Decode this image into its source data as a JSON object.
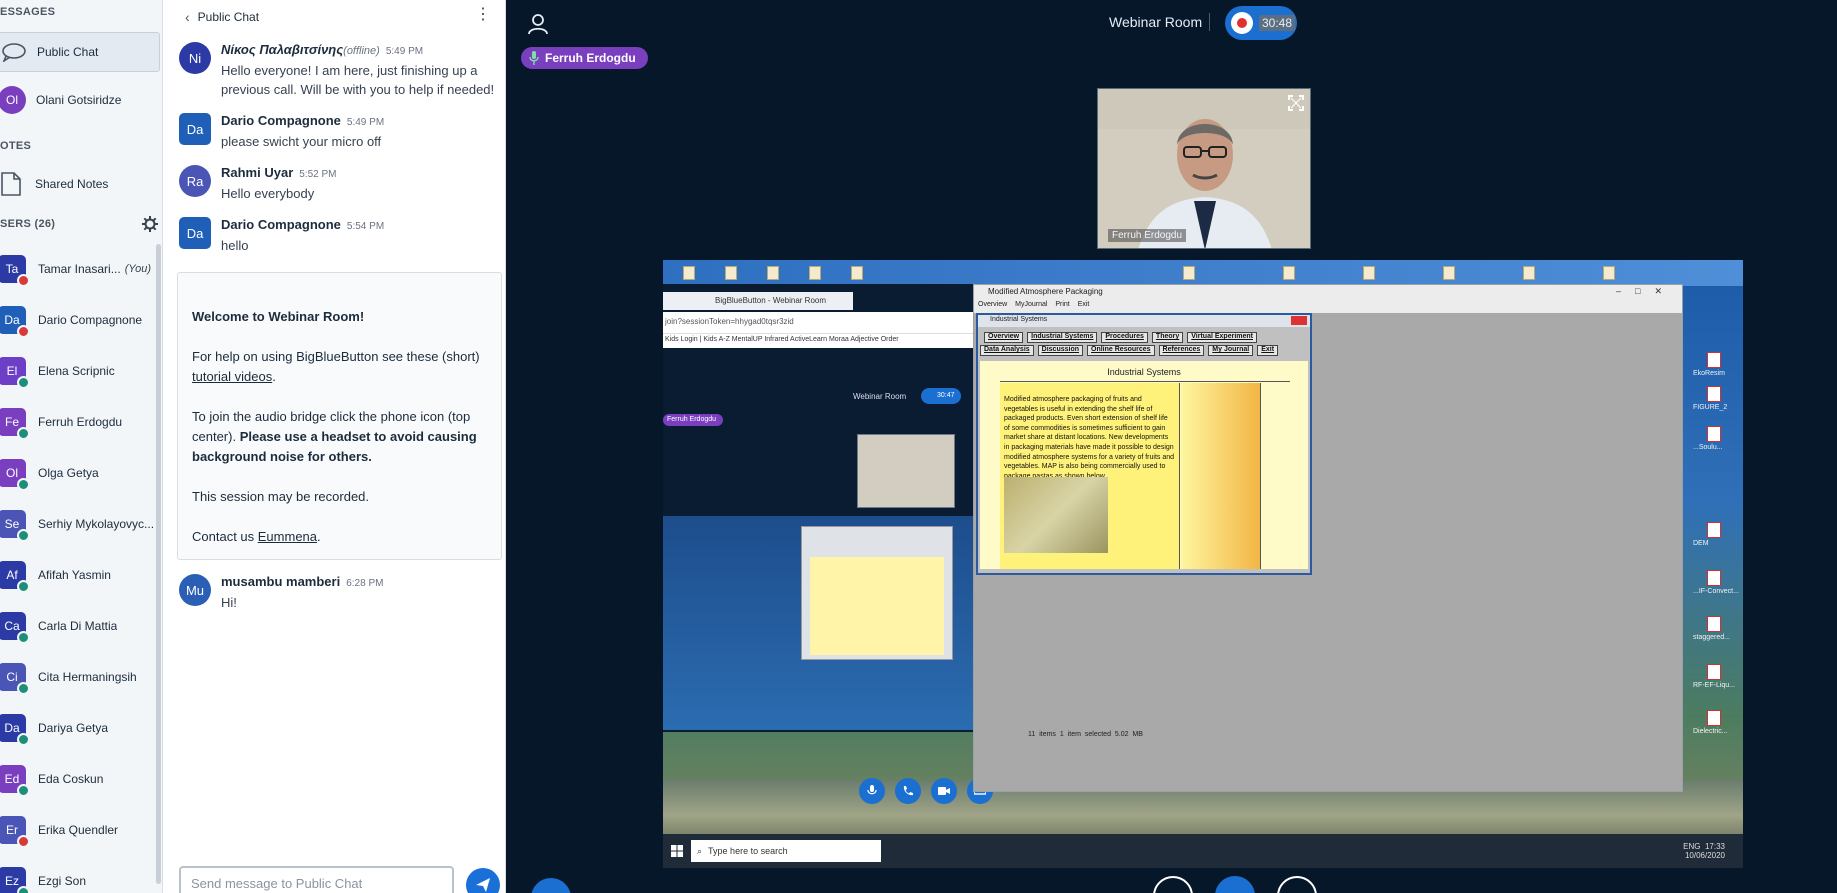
{
  "sidebar": {
    "messages_title": "ESSAGES",
    "public_chat_label": "Public Chat",
    "private_chat": {
      "initials": "Ol",
      "name": "Olani Gotsiridze"
    },
    "notes_title": "OTES",
    "shared_notes_label": "Shared Notes",
    "users_title": "SERS (26)",
    "you_label": "(You)",
    "users": [
      {
        "initials": "Ta",
        "name": "Tamar Inasari...",
        "color": "#2b3aa4",
        "status": "#d83a3a",
        "you": true
      },
      {
        "initials": "Da",
        "name": "Dario Compagnone",
        "color": "#1f5fb8",
        "status": "#d83a3a"
      },
      {
        "initials": "El",
        "name": "Elena Scripnic",
        "color": "#6c3fc6",
        "status": "#1b8f7a"
      },
      {
        "initials": "Fe",
        "name": "Ferruh Erdogdu",
        "color": "#7a3fbf",
        "status": "#1b8f7a"
      },
      {
        "initials": "Ol",
        "name": "Olga Getya",
        "color": "#7a3fbf",
        "status": "#1b8f7a"
      },
      {
        "initials": "Se",
        "name": "Serhiy Mykolayovyc...",
        "color": "#4a55b5",
        "status": "#1b8f7a"
      },
      {
        "initials": "Af",
        "name": "Afifah Yasmin",
        "color": "#2b3aa4",
        "status": "#1b8f7a"
      },
      {
        "initials": "Ca",
        "name": "Carla Di Mattia",
        "color": "#2b3aa4",
        "status": "#1b8f7a"
      },
      {
        "initials": "Ci",
        "name": "Cita Hermaningsih",
        "color": "#4a55b5",
        "status": "#1b8f7a"
      },
      {
        "initials": "Da",
        "name": "Dariya Getya",
        "color": "#2b3aa4",
        "status": "#1b8f7a"
      },
      {
        "initials": "Ed",
        "name": "Eda Coskun",
        "color": "#7a3fbf",
        "status": "#1b8f7a"
      },
      {
        "initials": "Er",
        "name": "Erika Quendler",
        "color": "#4a55b5",
        "status": "#d83a3a"
      },
      {
        "initials": "Ez",
        "name": "Ezgi Son",
        "color": "#2b3aa4",
        "status": "#1b8f7a"
      }
    ]
  },
  "chat": {
    "title": "Public Chat",
    "messages": [
      {
        "initials": "Ni",
        "name": "Νίκος Παλαβιτσίνης",
        "offline": "(offline)",
        "time": "5:49 PM",
        "text": "Hello everyone! I am here, just finishing up a previous call. Will be with you to help if needed!",
        "color": "#2b3aa4"
      },
      {
        "initials": "Da",
        "name": "Dario Compagnone",
        "time": "5:49 PM",
        "text": "please swicht your micro off",
        "color": "#1f5fb8"
      },
      {
        "initials": "Ra",
        "name": "Rahmi Uyar",
        "time": "5:52 PM",
        "text": "Hello everybody",
        "color": "#4a55b5"
      },
      {
        "initials": "Da",
        "name": "Dario Compagnone",
        "time": "5:54 PM",
        "text": "hello",
        "color": "#1f5fb8"
      },
      {
        "initials": "Mu",
        "name": "musambu mamberi",
        "time": "6:28 PM",
        "text": "Hi!",
        "color": "#2b5fb5"
      }
    ],
    "welcome": {
      "line1": "Welcome to Webinar Room!",
      "line2_pre": "For help on using BigBlueButton see these (short) ",
      "line2_link": "tutorial videos",
      "line2_post": ".",
      "line3_pre": "To join the audio bridge click the phone icon (top center). ",
      "line3_bold": "Please use a headset to avoid causing background noise for others.",
      "line4": "This session may be recorded.",
      "line5_pre": "Contact us ",
      "line5_link": "Eummena",
      "line5_post": "."
    },
    "input_placeholder": "Send message to Public Chat"
  },
  "main": {
    "room_title": "Webinar Room",
    "recording_time": "30:48",
    "talker": "Ferruh Erdogdu",
    "webcam_label": "Ferruh Erdogdu",
    "colors": {
      "accent": "#1a6fd1",
      "talker": "#7a3fbf",
      "background": "#06172a"
    }
  },
  "screen": {
    "nested_tab": "BigBlueButton - Webinar Room",
    "nested_url": "join?sessionToken=hhygad0tqsr3zid",
    "nested_bookmarks": "Kids Login | Kids A-Z   MentalUP   Infrared   ActiveLearn   Moraa   Adjective Order",
    "nested_room": "Webinar Room",
    "nested_time": "30:47",
    "nested_talker": "Ferruh Erdogdu",
    "window_title": "Modified Atmosphere Packaging",
    "window_menu": "Overview MyJournal Print Exit",
    "app_title": "Industrial Systems",
    "nav_row1": [
      "Overview",
      "Industrial Systems",
      "Procedures",
      "Theory",
      "Virtual Experiment"
    ],
    "nav_row2": [
      "Data Analysis",
      "Discussion",
      "Online Resources",
      "References",
      "My Journal",
      "Exit"
    ],
    "page_heading": "Industrial Systems",
    "page_text": "Modified atmosphere packaging of fruits and vegetables is useful in extending the shelf life of packaged products. Even short extension of shelf life of some commodities is sometimes sufficient to gain market share at distant locations. New developments in packaging materials have made it possible to design modified atmosphere systems for a variety of fruits and vegetables. MAP is also being commercially used to package pastas as shown below.",
    "status_bar": "11 items    1 item selected  5.02 MB",
    "desktop_files": [
      "EkoResim",
      "FIGURE_2",
      "...Soulu...",
      "DEM",
      "...IF-Convect...",
      "staggered...",
      "RF-EF-Liqu...",
      "Dielectric..."
    ],
    "search_placeholder": "Type here to search",
    "tray_time": "17:33",
    "tray_date": "10/06/2020",
    "tray_lang": "ENG"
  }
}
